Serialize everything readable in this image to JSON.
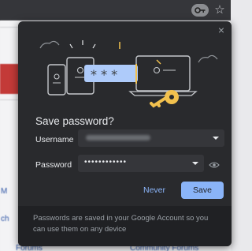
{
  "browser": {
    "key_icon": "key-icon",
    "star_icon": "bookmark-star-icon",
    "star_glyph": "☆"
  },
  "background_page": {
    "left_snippets": [
      "M",
      "ch",
      "Forums"
    ],
    "right_snippet": "Community Forums"
  },
  "dialog": {
    "close_glyph": "×",
    "title": "Save password?",
    "username": {
      "label": "Username",
      "value_redacted": true
    },
    "password": {
      "label": "Password",
      "value": "••••••••••••"
    },
    "buttons": {
      "never": "Never",
      "save": "Save"
    },
    "footer": "Passwords are saved in your Google Account so you can use them on any device"
  },
  "colors": {
    "dialog_bg": "#292a2d",
    "accent": "#8ab4f8",
    "key_gold": "#f2c14e",
    "field_bg": "#35363a"
  }
}
